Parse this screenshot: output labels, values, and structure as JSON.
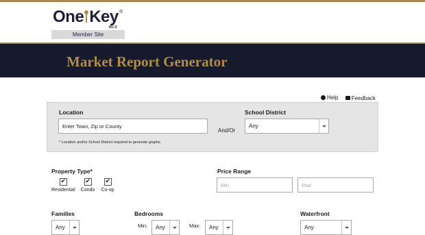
{
  "brand": {
    "logo_text_left": "One",
    "logo_text_right": "Key",
    "logo_sub": "MLS",
    "logo_mark": "®",
    "member_site": "Member Site"
  },
  "banner": {
    "title": "Market Report Generator"
  },
  "help": {
    "help_label": "Help",
    "feedback_label": "Feedback"
  },
  "location": {
    "label": "Location",
    "input_value": "Enter Town, Zip or County",
    "and_or": "And/Or",
    "note": "* Location and/or School District required to generate graphs."
  },
  "school_district": {
    "label": "School District",
    "selected": "Any"
  },
  "property_type": {
    "label": "Property Type*",
    "options": [
      {
        "label": "Residential",
        "checked": true
      },
      {
        "label": "Condo",
        "checked": true
      },
      {
        "label": "Co-op",
        "checked": true
      }
    ]
  },
  "price_range": {
    "label": "Price Range",
    "min_placeholder": "Min",
    "max_placeholder": "Max"
  },
  "families": {
    "label": "Families",
    "selected": "Any"
  },
  "bedrooms": {
    "label": "Bedrooms",
    "min_label": "Min:",
    "min_selected": "Any",
    "max_label": "Max:",
    "max_selected": "Any"
  },
  "waterfront": {
    "label": "Waterfront",
    "selected": "Any"
  },
  "colors": {
    "gold": "#b08d4a",
    "navy": "#171a2d",
    "panel": "#e5e5e5"
  }
}
